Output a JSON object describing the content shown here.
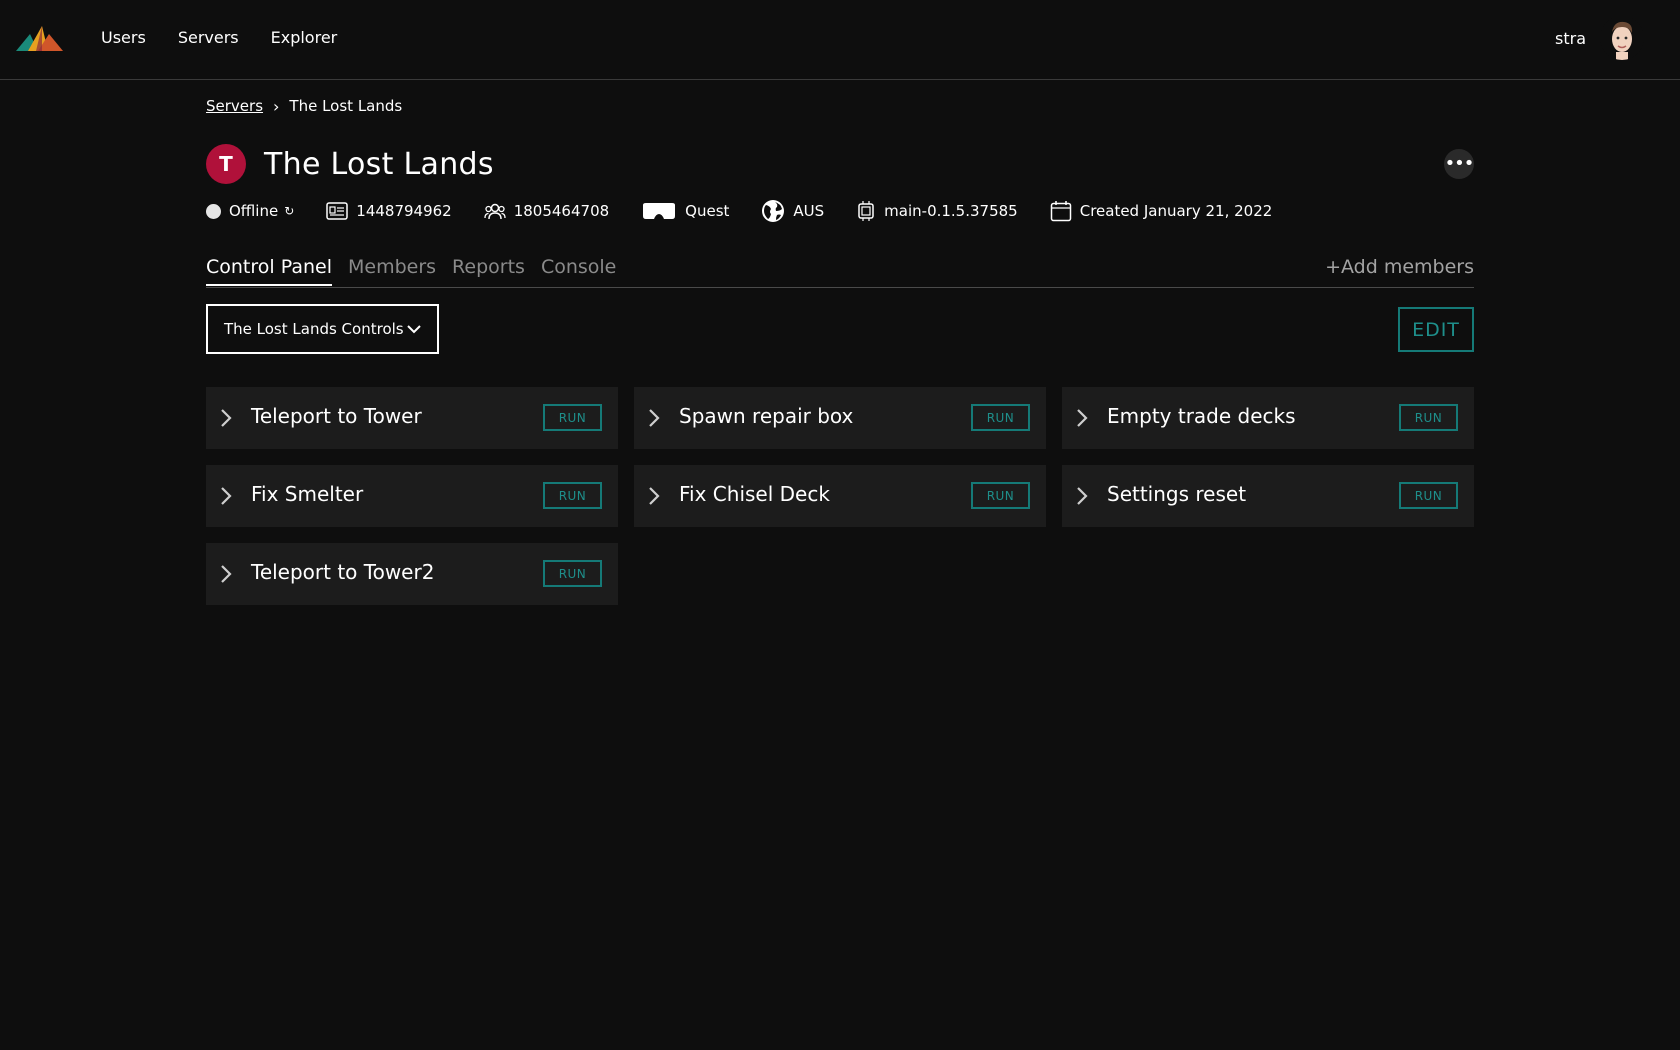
{
  "nav": {
    "logo_icon": "mountain-logo-icon",
    "links": [
      "Users",
      "Servers",
      "Explorer"
    ],
    "username": "stra",
    "avatar_icon": "user-avatar-icon"
  },
  "breadcrumb": {
    "parent": "Servers",
    "separator": "›",
    "current": "The Lost Lands"
  },
  "server": {
    "initial": "T",
    "initial_color": "#b0113a",
    "title": "The Lost Lands",
    "more_icon": "ellipsis-icon",
    "more_label": "•••",
    "meta": {
      "status": "Offline",
      "refresh_glyph": "↻",
      "id": "1448794962",
      "group_id": "1805464708",
      "platform": "Quest",
      "region": "AUS",
      "version": "main-0.1.5.37585",
      "created": "Created January 21, 2022"
    }
  },
  "tabs": {
    "items": [
      "Control Panel",
      "Members",
      "Reports",
      "Console"
    ],
    "active": "Control Panel",
    "add_members": "+Add members"
  },
  "controls": {
    "select_value": "The Lost Lands Controls",
    "edit_label": "EDIT",
    "accent_color": "#157a77"
  },
  "commands": [
    {
      "label": "Teleport to Tower",
      "run": "RUN"
    },
    {
      "label": "Spawn repair box",
      "run": "RUN"
    },
    {
      "label": "Empty trade decks",
      "run": "RUN"
    },
    {
      "label": "Fix Smelter",
      "run": "RUN"
    },
    {
      "label": "Fix Chisel Deck",
      "run": "RUN"
    },
    {
      "label": "Settings reset",
      "run": "RUN"
    },
    {
      "label": "Teleport to Tower2",
      "run": "RUN"
    }
  ]
}
